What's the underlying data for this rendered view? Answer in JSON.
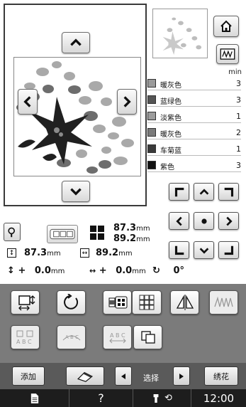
{
  "colors": {
    "panel": "#7b7b7b",
    "cmd_bar": "#5a5a5a",
    "status_bar": "#1d1d1d"
  },
  "thread_list": {
    "min_label": "min",
    "items": [
      {
        "name": "暖灰色",
        "count": "3",
        "swatch": "#9a9a9a"
      },
      {
        "name": "蓝绿色",
        "count": "3",
        "swatch": "#555555"
      },
      {
        "name": "淡紫色",
        "count": "1",
        "swatch": "#9c9c9c"
      },
      {
        "name": "暖灰色",
        "count": "2",
        "swatch": "#7a7a7a"
      },
      {
        "name": "车菊蓝",
        "count": "1",
        "swatch": "#3a3a3a"
      },
      {
        "name": "紫色",
        "count": "3",
        "swatch": "#111111"
      }
    ]
  },
  "design_info": {
    "size_width": "87.3",
    "size_height": "89.2",
    "unit": "mm",
    "height_value": "87.3",
    "width_value": "89.2",
    "offset_y": "0.0",
    "offset_x": "0.0",
    "rotation": "0°",
    "plus_sign": "+"
  },
  "commands": {
    "add": "添加",
    "select": "选择",
    "embroider": "绣花"
  },
  "status": {
    "help": "?",
    "time": "12:00"
  }
}
